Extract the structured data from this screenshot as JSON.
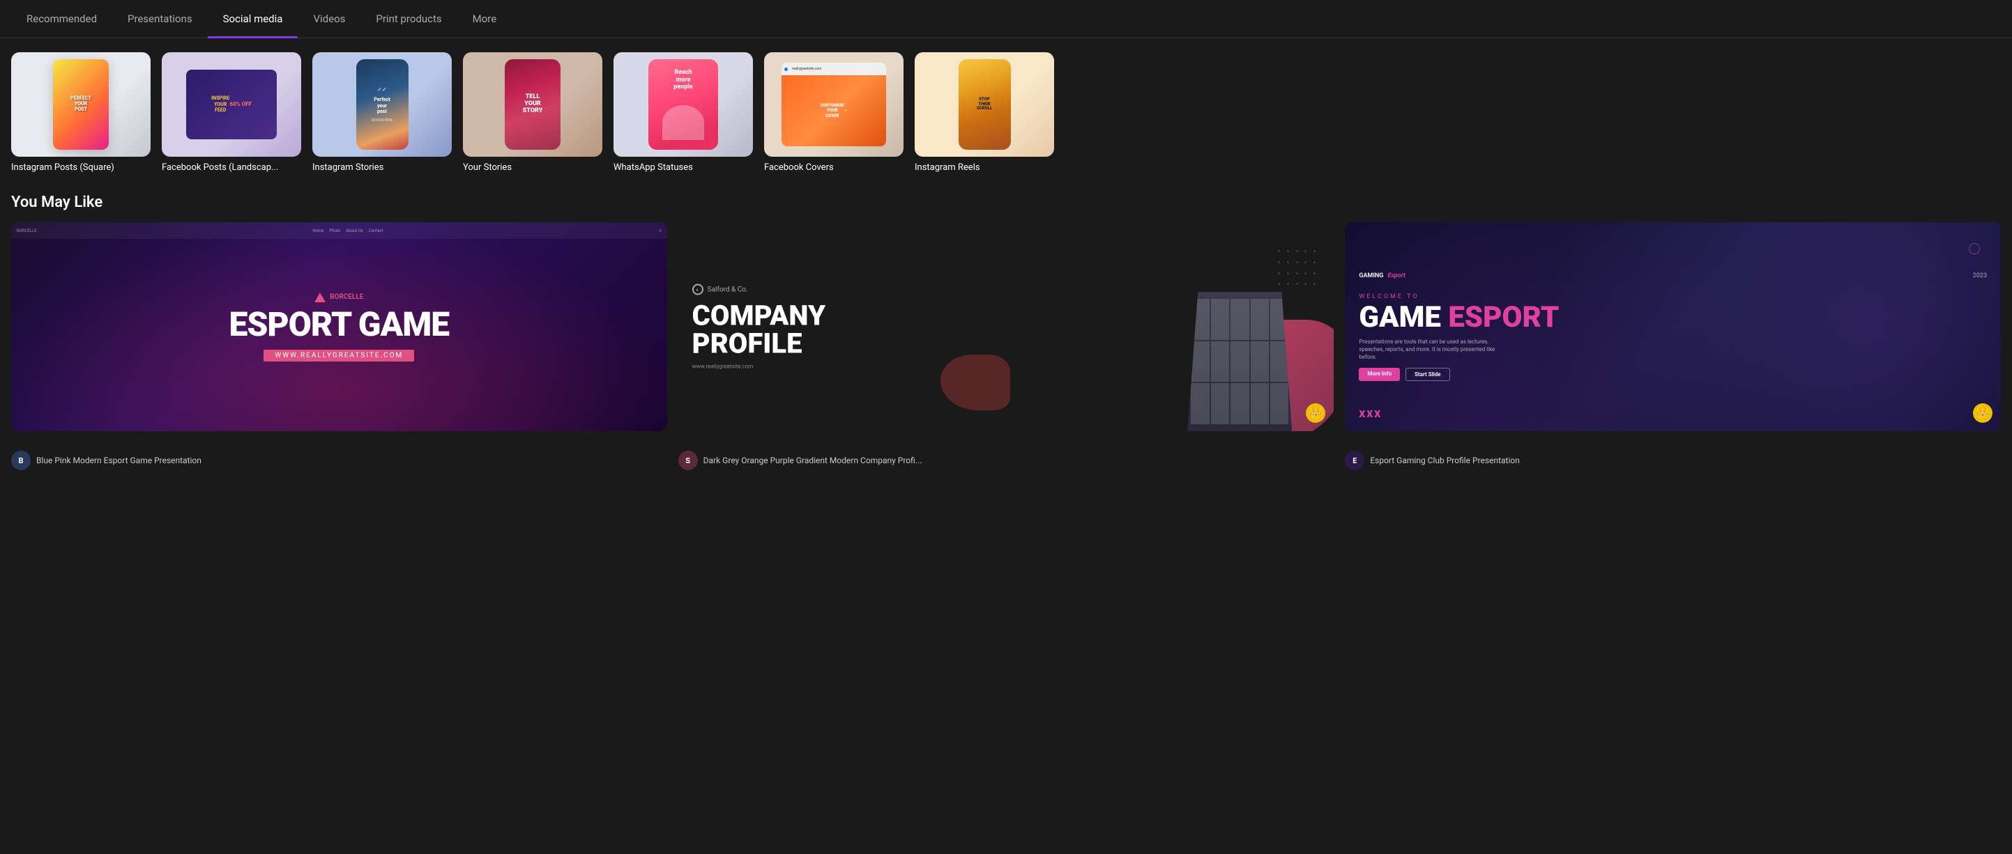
{
  "nav": {
    "tabs": [
      {
        "id": "recommended",
        "label": "Recommended",
        "active": false
      },
      {
        "id": "presentations",
        "label": "Presentations",
        "active": false
      },
      {
        "id": "social-media",
        "label": "Social media",
        "active": true
      },
      {
        "id": "videos",
        "label": "Videos",
        "active": false
      },
      {
        "id": "print-products",
        "label": "Print products",
        "active": false
      },
      {
        "id": "more",
        "label": "More",
        "active": false
      }
    ]
  },
  "categories": [
    {
      "id": "instagram-posts",
      "label": "Instagram Posts (Square)",
      "type": "insta-sq"
    },
    {
      "id": "facebook-posts",
      "label": "Facebook Posts (Landscap...",
      "type": "fb"
    },
    {
      "id": "instagram-stories",
      "label": "Instagram Stories",
      "type": "ig-stories"
    },
    {
      "id": "your-stories",
      "label": "Your Stories",
      "type": "your-stories"
    },
    {
      "id": "whatsapp",
      "label": "WhatsApp Statuses",
      "type": "whatsapp"
    },
    {
      "id": "facebook-covers",
      "label": "Facebook Covers",
      "type": "fb-covers"
    },
    {
      "id": "instagram-reels",
      "label": "Instagram Reels",
      "type": "ig-reels"
    }
  ],
  "section": {
    "you_may_like": "You May Like"
  },
  "templates": [
    {
      "id": "esport-game",
      "name": "Blue Pink Modern Esport Game Presentation",
      "type": "esport",
      "avatar_color": "#2a3a5a",
      "avatar_letter": "B"
    },
    {
      "id": "company-profile",
      "name": "Dark Grey Orange Purple Gradient Modern Company Profi...",
      "type": "company",
      "avatar_color": "#5a2a3a",
      "avatar_letter": "S",
      "has_crown": true
    },
    {
      "id": "game-esport",
      "name": "Esport Gaming Club Profile Presentation",
      "type": "game",
      "avatar_color": "#2a1a4a",
      "avatar_letter": "E",
      "has_crown": true
    }
  ],
  "whatsapp_card": {
    "headline": "Reach more people",
    "subtitle": "WhatsApp Statuses"
  },
  "esport_card": {
    "logo": "BORCELLE",
    "title": "ESPORT GAME",
    "url": "WWW.REALLYGREATSITE.COM",
    "nav_items": [
      "Home",
      "Photo",
      "About Us",
      "Contact"
    ]
  },
  "company_card": {
    "logo_text": "Salford & Co.",
    "title_line1": "COMPANY",
    "title_line2": "PROFILE",
    "url": "www.reallygreatsite.com"
  },
  "game_card": {
    "label_gaming": "GAMING",
    "label_esport": "Esport",
    "year": "2023",
    "welcome": "WELCOME TO",
    "title_white": "GAME",
    "title_pink": "ESPORT",
    "description": "Presentations are tools that can be used as lectures, speeches, reports, and more. It is mostly presented like before.",
    "btn1": "More Info",
    "btn2": "Start Slide",
    "xxx": "XXX"
  }
}
